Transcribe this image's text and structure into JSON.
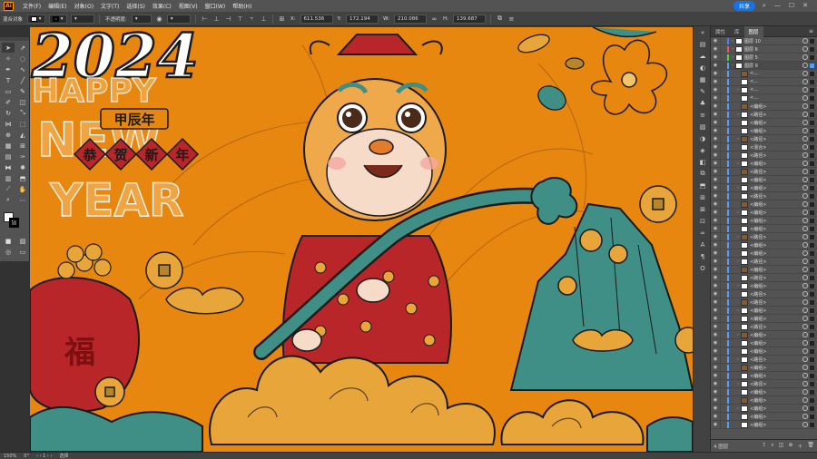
{
  "app": {
    "logo": "Ai"
  },
  "menu": [
    "文件(F)",
    "编辑(E)",
    "对象(O)",
    "文字(T)",
    "选择(S)",
    "效果(C)",
    "视图(V)",
    "窗口(W)",
    "帮助(H)"
  ],
  "share_label": "共享",
  "control": {
    "object_type": "混合对象",
    "opacity_label": "不透明度:",
    "x_value": "611.536",
    "y_value": "172.194",
    "w_value": "210.086",
    "h_value": "139.687"
  },
  "canvas_art": {
    "year": "2024",
    "happy": "HAPPY",
    "new": "NEW",
    "year_word": "YEAR",
    "stamp_top": "甲辰年",
    "stamp_chars": [
      "恭",
      "贺",
      "新",
      "年"
    ],
    "bag_char": "福",
    "colors": {
      "background": "#e8870f",
      "teal": "#3f8f87",
      "red": "#b8262a",
      "gold": "#e8a53a"
    }
  },
  "layers_panel": {
    "tabs": [
      "属性",
      "库",
      "图层"
    ],
    "active_tab": "图层",
    "rows": [
      {
        "name": "图层 10",
        "type": "layer",
        "color": "#4f7cff",
        "selected": false
      },
      {
        "name": "图层 6",
        "type": "layer",
        "color": "#ff4f4f",
        "selected": false
      },
      {
        "name": "图层 5",
        "type": "layer",
        "color": "#4fd04f",
        "selected": false
      },
      {
        "name": "图层 9",
        "type": "layer",
        "color": "#4ea0ff",
        "selected": true
      },
      {
        "name": "<...",
        "type": "sub",
        "color": "#4ea0ff",
        "selected": false
      },
      {
        "name": "<...",
        "type": "sub",
        "color": "#4ea0ff",
        "selected": false
      },
      {
        "name": "<...",
        "type": "sub",
        "color": "#4ea0ff",
        "selected": false
      },
      {
        "name": "<...",
        "type": "sub",
        "color": "#4ea0ff",
        "selected": false
      },
      {
        "name": "<编组>",
        "type": "sub",
        "color": "#4ea0ff",
        "selected": false
      },
      {
        "name": "<路径>",
        "type": "sub",
        "color": "#4ea0ff",
        "selected": false
      },
      {
        "name": "<编组>",
        "type": "sub",
        "color": "#4ea0ff",
        "selected": false
      },
      {
        "name": "<编组>",
        "type": "sub",
        "color": "#4ea0ff",
        "selected": false
      },
      {
        "name": "<路径>",
        "type": "sub",
        "color": "#4ea0ff",
        "selected": false
      },
      {
        "name": "<混合>",
        "type": "sub",
        "color": "#4ea0ff",
        "selected": false
      },
      {
        "name": "<路径>",
        "type": "sub",
        "color": "#4ea0ff",
        "selected": false
      },
      {
        "name": "<编组>",
        "type": "sub",
        "color": "#4ea0ff",
        "selected": false
      },
      {
        "name": "<路径>",
        "type": "sub",
        "color": "#4ea0ff",
        "selected": false
      },
      {
        "name": "<编组>",
        "type": "sub",
        "color": "#4ea0ff",
        "selected": false
      },
      {
        "name": "<编组>",
        "type": "sub",
        "color": "#4ea0ff",
        "selected": false
      },
      {
        "name": "<路径>",
        "type": "sub",
        "color": "#4ea0ff",
        "selected": false
      },
      {
        "name": "<编组>",
        "type": "sub",
        "color": "#4ea0ff",
        "selected": false
      },
      {
        "name": "<编组>",
        "type": "sub",
        "color": "#4ea0ff",
        "selected": false
      },
      {
        "name": "<编组>",
        "type": "sub",
        "color": "#4ea0ff",
        "selected": false
      },
      {
        "name": "<编组>",
        "type": "sub",
        "color": "#4ea0ff",
        "selected": false
      },
      {
        "name": "<路径>",
        "type": "sub",
        "color": "#4ea0ff",
        "selected": false
      },
      {
        "name": "<编组>",
        "type": "sub",
        "color": "#4ea0ff",
        "selected": false
      },
      {
        "name": "<编组>",
        "type": "sub",
        "color": "#4ea0ff",
        "selected": false
      },
      {
        "name": "<路径>",
        "type": "sub",
        "color": "#4ea0ff",
        "selected": false
      },
      {
        "name": "<编组>",
        "type": "sub",
        "color": "#4ea0ff",
        "selected": false
      },
      {
        "name": "<路径>",
        "type": "sub",
        "color": "#4ea0ff",
        "selected": false
      },
      {
        "name": "<编组>",
        "type": "sub",
        "color": "#4ea0ff",
        "selected": false
      },
      {
        "name": "<路径>",
        "type": "sub",
        "color": "#4ea0ff",
        "selected": false
      },
      {
        "name": "<路径>",
        "type": "sub",
        "color": "#4ea0ff",
        "selected": false
      },
      {
        "name": "<编组>",
        "type": "sub",
        "color": "#4ea0ff",
        "selected": false
      },
      {
        "name": "<编组>",
        "type": "sub",
        "color": "#4ea0ff",
        "selected": false
      },
      {
        "name": "<路径>",
        "type": "sub",
        "color": "#4ea0ff",
        "selected": false
      },
      {
        "name": "<编组>",
        "type": "sub",
        "color": "#4ea0ff",
        "selected": false
      },
      {
        "name": "<编组>",
        "type": "sub",
        "color": "#4ea0ff",
        "selected": false
      },
      {
        "name": "<编组>",
        "type": "sub",
        "color": "#4ea0ff",
        "selected": false
      },
      {
        "name": "<路径>",
        "type": "sub",
        "color": "#4ea0ff",
        "selected": false
      },
      {
        "name": "<编组>",
        "type": "sub",
        "color": "#4ea0ff",
        "selected": false
      },
      {
        "name": "<编组>",
        "type": "sub",
        "color": "#4ea0ff",
        "selected": false
      },
      {
        "name": "<路径>",
        "type": "sub",
        "color": "#4ea0ff",
        "selected": false
      },
      {
        "name": "<编组>",
        "type": "sub",
        "color": "#4ea0ff",
        "selected": false
      },
      {
        "name": "<编组>",
        "type": "sub",
        "color": "#4ea0ff",
        "selected": false
      },
      {
        "name": "<编组>",
        "type": "sub",
        "color": "#4ea0ff",
        "selected": false
      },
      {
        "name": "<编组>",
        "type": "sub",
        "color": "#4ea0ff",
        "selected": false
      },
      {
        "name": "<编组>",
        "type": "sub",
        "color": "#4ea0ff",
        "selected": false
      }
    ],
    "footer_label": "4 图层"
  },
  "status": {
    "zoom": "150%",
    "rotation": "0°",
    "tool_label": "选择"
  }
}
